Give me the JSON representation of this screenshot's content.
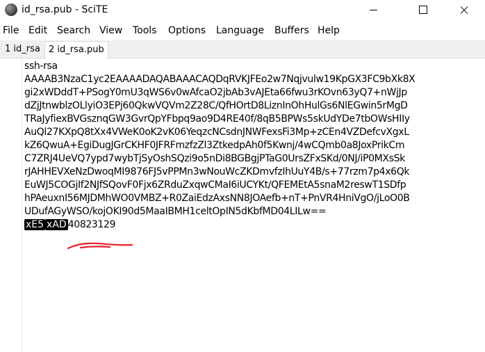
{
  "window": {
    "title": "id_rsa.pub - SciTE"
  },
  "menu": {
    "items": [
      "File",
      "Edit",
      "Search",
      "View",
      "Tools",
      "Options",
      "Language",
      "Buffers",
      "Help"
    ]
  },
  "tabs": [
    {
      "label": "1 id_rsa"
    },
    {
      "label": "2 id_rsa.pub"
    }
  ],
  "editor": {
    "lines": [
      "ssh-rsa",
      "AAAAB3NzaC1yc2EAAAADAQABAAACAQDqRVKJFEo2w7Nqjvulw19KpGX3FC9bXk8X",
      "gi2xWDddT+PSogY0mU3qWS6v0wAfcaO2jbAb3vAJEta66fwu3rKOvn63yQ7+nWjJp",
      "dZjJtnwblzOLlyiO3EPj60QkwVQVm2Z28C/QfHOrtD8LiznInOhHulGs6NlEGwin5rMgD",
      "TRaJyfiexBVGsznqGW3GvrQpYFbpq9ao9D4RE40f/8qB5BPWs5skUdYDe7tbOWsHIIy",
      "AuQl27KXpQ8tXx4VWeK0oK2vK06YeqzcNCsdnJNWFexsFi3Mp+zCEn4VZDefcvXgxL",
      "kZ6QwuA+EgiDugJGrCKHF0JFRFmzfzZl3ZtkedpAh0f5Kwnj/4wCQmb0a8JoxPrikCm",
      "C7ZRJ4UeVQ7ypd7wybTjSyOshSQzi9o5nDi8BGBgjPTaG0UrsZFxSKd/0NJ/iP0MXsSk",
      "rJAHHEVXeNzDwoqMI9876FJ5vPPMn3wNouWcZKDmvfzIhUuY4B/s+77rzm7p4x6Qk",
      "EuWJ5COGjIf2NJfSQovF0Fjx6ZRduZxqwCMaI6iUCYKt/QFEMEtA5snaM2reswT1SDfp",
      "hPAeuxnI56MJDMhWO0VMBZ+R0ZaiEdzAxsNN8JOAefb+nT+PnVR4HniVgO/jLoO0B",
      "UDufAGyWSO/kojOKI90d5MaaIBMH1celtOpIN5dKbfMD04LILw=="
    ],
    "last_line": {
      "ctrl_1": "xE5",
      "ctrl_2": "xAD",
      "text": "40823129"
    },
    "annotation_color": "#e8202a"
  }
}
